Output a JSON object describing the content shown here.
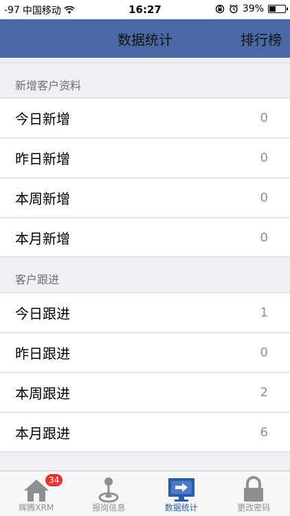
{
  "status_bar": {
    "signal": "-97",
    "carrier": "中国移动",
    "time": "16:27",
    "battery": "39%"
  },
  "nav": {
    "title": "数据统计",
    "right_button": "排行榜"
  },
  "sections": [
    {
      "header": "新增客户资料",
      "rows": [
        {
          "label": "今日新增",
          "value": "0"
        },
        {
          "label": "昨日新增",
          "value": "0"
        },
        {
          "label": "本周新增",
          "value": "0"
        },
        {
          "label": "本月新增",
          "value": "0"
        }
      ]
    },
    {
      "header": "客户跟进",
      "rows": [
        {
          "label": "今日跟进",
          "value": "1"
        },
        {
          "label": "昨日跟进",
          "value": "0"
        },
        {
          "label": "本周跟进",
          "value": "2"
        },
        {
          "label": "本月跟进",
          "value": "6"
        }
      ]
    }
  ],
  "tabs": [
    {
      "label": "辉腾XRM",
      "icon": "home-icon",
      "badge": "34"
    },
    {
      "label": "报岗信息",
      "icon": "joystick-icon"
    },
    {
      "label": "数据统计",
      "icon": "monitor-icon",
      "active": true
    },
    {
      "label": "更改密码",
      "icon": "lock-icon"
    }
  ],
  "colors": {
    "nav_background": "#4a6aa6",
    "active_tab": "#2a5aa8",
    "badge": "#e33333"
  }
}
